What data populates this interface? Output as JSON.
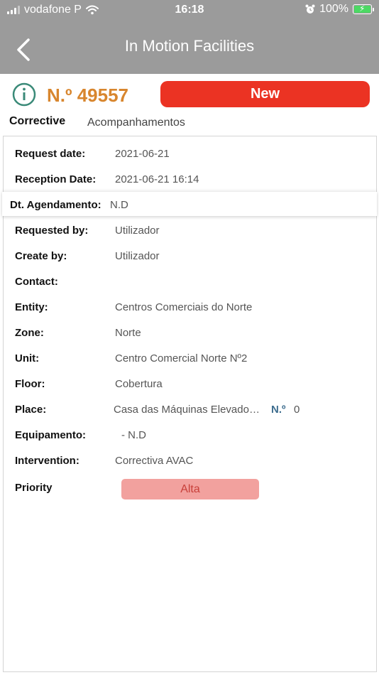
{
  "status_bar": {
    "carrier": "vodafone P",
    "time": "16:18",
    "battery": "100%"
  },
  "nav": {
    "title": "In Motion Facilities"
  },
  "ticket": {
    "number": "N.º 49557",
    "status_label": "New"
  },
  "tabs": {
    "corrective": "Corrective",
    "acompanhamentos": "Acompanhamentos"
  },
  "details": [
    {
      "label": "Request date:",
      "value": "2021-06-21"
    },
    {
      "label": "Reception Date:",
      "value": "2021-06-21 16:14"
    },
    {
      "label": "Dt. Agendamento:",
      "value": "N.D"
    },
    {
      "label": "Requested by:",
      "value": "Utilizador"
    },
    {
      "label": "Create by:",
      "value": "Utilizador"
    },
    {
      "label": "Contact:",
      "value": ""
    },
    {
      "label": "Entity:",
      "value": "Centros Comerciais do Norte"
    },
    {
      "label": "Zone:",
      "value": "Norte"
    },
    {
      "label": "Unit:",
      "value": "Centro Comercial Norte Nº2"
    },
    {
      "label": "Floor:",
      "value": "Cobertura"
    },
    {
      "label": "Place:",
      "value": "Casa das Máquinas Elevado…",
      "no_label": "N.º",
      "no_value": "0"
    },
    {
      "label": "Equipamento:",
      "value": "- N.D"
    },
    {
      "label": "Intervention:",
      "value": "Correctiva AVAC"
    },
    {
      "label": "Priority",
      "value": "Alta"
    }
  ],
  "colors": {
    "header_bg": "#9b9b9b",
    "ticket_number": "#d8862e",
    "new_button": "#eb3323",
    "priority_bg": "#f2a19e",
    "priority_text": "#c8403a",
    "info_icon": "#3a8a78"
  }
}
